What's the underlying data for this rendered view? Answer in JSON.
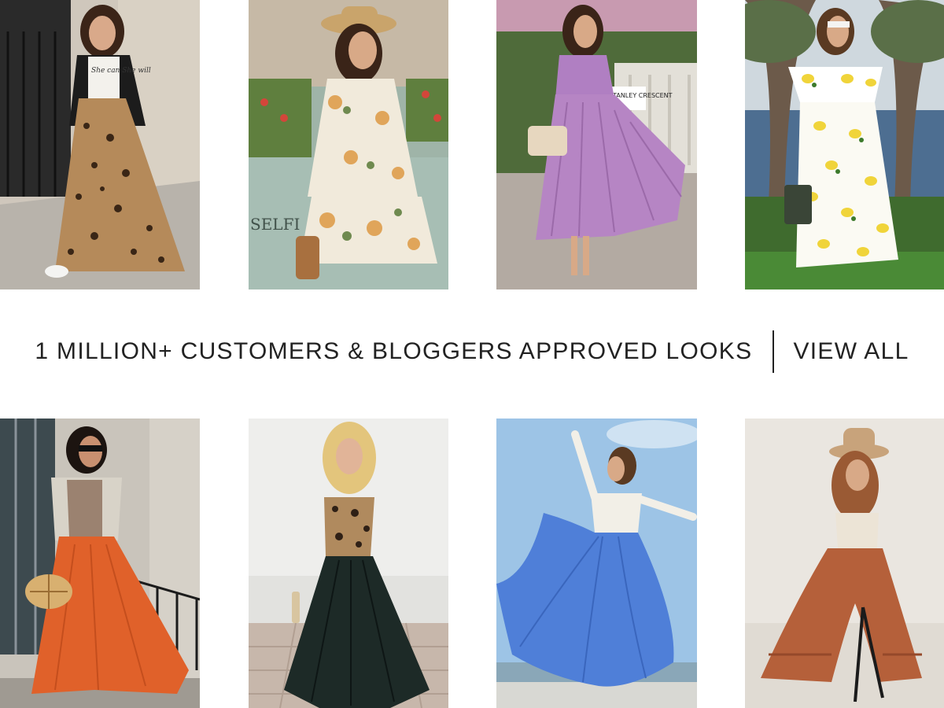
{
  "banner": {
    "headline": "1 MILLION+ CUSTOMERS & BLOGGERS APPROVED LOOKS",
    "view_all_label": "VIEW ALL"
  },
  "gallery": {
    "top_row": [
      {
        "look": "leopard print maxi skirt with leather jacket and graphic tee",
        "shirt_text": "She can She will"
      },
      {
        "look": "floral cutout mini dress with straw hat",
        "sign_text": "SELFI"
      },
      {
        "look": "lilac pleated midi dress with quilted handbag",
        "sign_text": "STANLEY CRESCENT"
      },
      {
        "look": "lemon print off-shoulder maxi dress by the lake"
      }
    ],
    "bottom_row": [
      {
        "look": "orange chiffon maxi skirt with blazer and bamboo bag"
      },
      {
        "look": "black chiffon maxi skirt with leopard bodysuit"
      },
      {
        "look": "blue flowing maxi skirt with white top"
      },
      {
        "look": "rust tiered wide-leg pants with fedora"
      }
    ]
  },
  "colors": {
    "text": "#222222",
    "background": "#ffffff"
  }
}
